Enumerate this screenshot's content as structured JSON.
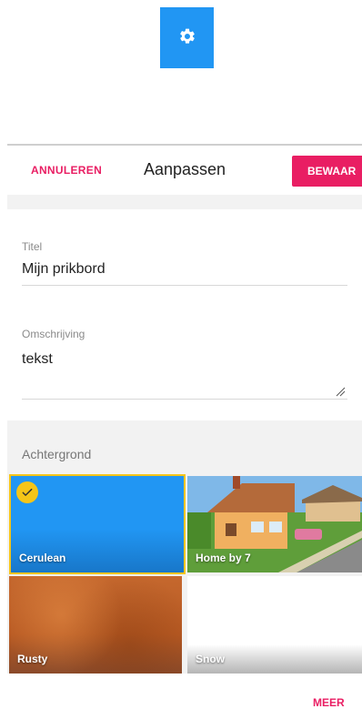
{
  "top": {
    "settings_icon": "gear-icon",
    "accent_color": "#2196f3"
  },
  "header": {
    "cancel_label": "ANNULEREN",
    "title": "Aanpassen",
    "save_label": "BEWAAR",
    "accent_color": "#e91e63"
  },
  "form": {
    "title_label": "Titel",
    "title_value": "Mijn prikbord",
    "description_label": "Omschrijving",
    "description_value": "tekst"
  },
  "background": {
    "label": "Achtergrond",
    "selected": "Cerulean",
    "options": [
      {
        "name": "Cerulean",
        "color": "#2196f3"
      },
      {
        "name": "Home by 7",
        "color": "#7fb8e8"
      },
      {
        "name": "Rusty",
        "color": "#c5682e"
      },
      {
        "name": "Snow",
        "color": "#ffffff"
      }
    ],
    "more_label": "MEER"
  }
}
